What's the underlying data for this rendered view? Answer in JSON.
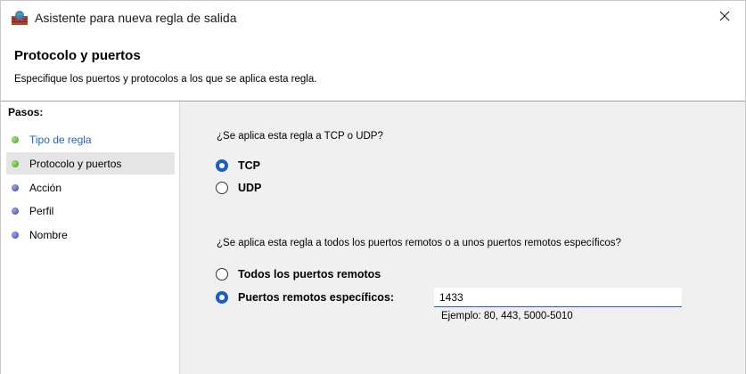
{
  "window": {
    "title": "Asistente para nueva regla de salida",
    "close_icon": "close-icon"
  },
  "header": {
    "title": "Protocolo y puertos",
    "description": "Especifique los puertos y protocolos a los que se aplica esta regla."
  },
  "sidebar": {
    "heading": "Pasos:",
    "steps": [
      {
        "label": "Tipo de regla",
        "status": "done"
      },
      {
        "label": "Protocolo y puertos",
        "status": "current"
      },
      {
        "label": "Acción",
        "status": "todo"
      },
      {
        "label": "Perfil",
        "status": "todo"
      },
      {
        "label": "Nombre",
        "status": "todo"
      }
    ]
  },
  "protocol": {
    "question": "¿Se aplica esta regla a TCP o UDP?",
    "options": [
      {
        "label": "TCP",
        "selected": true
      },
      {
        "label": "UDP",
        "selected": false
      }
    ]
  },
  "ports": {
    "question": "¿Se aplica esta regla a todos los puertos remotos o a unos puertos remotos específicos?",
    "options": [
      {
        "label": "Todos los puertos remotos",
        "selected": false
      },
      {
        "label": "Puertos remotos específicos:",
        "selected": true
      }
    ],
    "value": "1433",
    "example": "Ejemplo: 80, 443, 5000-5010"
  },
  "colors": {
    "accent": "#1a5fc2",
    "link": "#1f63c6",
    "main_bg": "#f0f0f0"
  }
}
